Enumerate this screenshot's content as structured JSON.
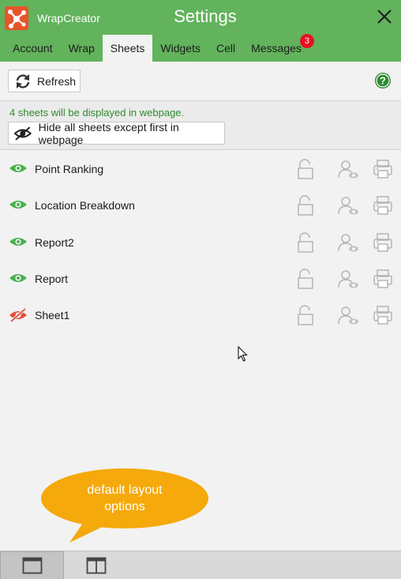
{
  "app": {
    "name": "WrapCreator",
    "title": "Settings",
    "accent_color": "#62b35c",
    "logo_color": "#e8542a"
  },
  "tabs": [
    {
      "label": "Account",
      "active": false
    },
    {
      "label": "Wrap",
      "active": false
    },
    {
      "label": "Sheets",
      "active": true
    },
    {
      "label": "Widgets",
      "active": false
    },
    {
      "label": "Cell",
      "active": false
    },
    {
      "label": "Messages",
      "active": false,
      "badge": "3"
    }
  ],
  "toolbar": {
    "refresh_label": "Refresh",
    "help_icon": "help-icon"
  },
  "info": {
    "message": "4 sheets will be displayed in webpage.",
    "hide_button_label": "Hide all sheets except first in webpage",
    "message_color": "#2e8b2e"
  },
  "sheets": [
    {
      "name": "Point Ranking",
      "visible": true
    },
    {
      "name": "Location Breakdown",
      "visible": true
    },
    {
      "name": "Report2",
      "visible": true
    },
    {
      "name": "Report",
      "visible": true
    },
    {
      "name": "Sheet1",
      "visible": false
    }
  ],
  "callout": {
    "line1": "default layout",
    "line2": "options",
    "color": "#f5a90a"
  },
  "layout_options": [
    {
      "name": "single-pane-layout",
      "selected": true
    },
    {
      "name": "split-pane-layout",
      "selected": false
    }
  ]
}
